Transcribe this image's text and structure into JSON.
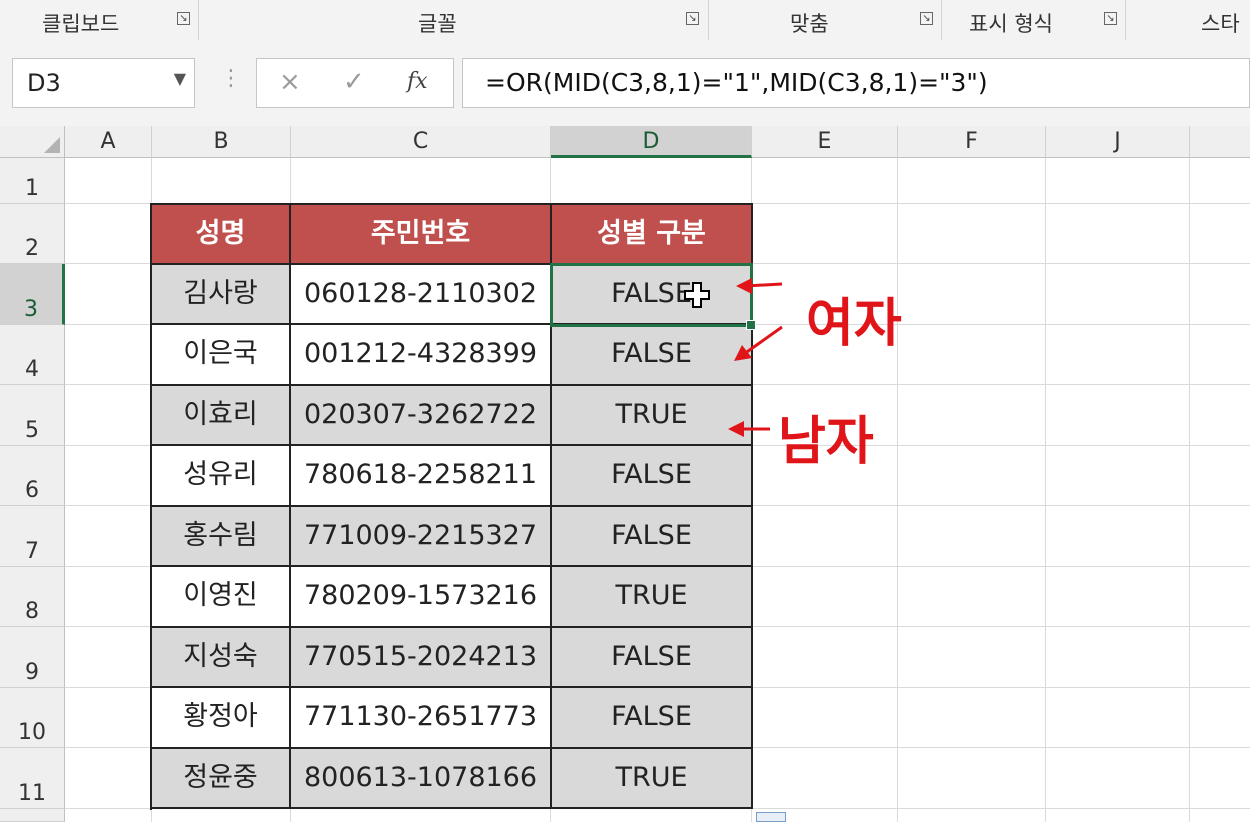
{
  "ribbon": {
    "groups": [
      {
        "label": "클립보드"
      },
      {
        "label": "글꼴"
      },
      {
        "label": "맞춤"
      },
      {
        "label": "표시 형식"
      },
      {
        "label": "스타"
      }
    ]
  },
  "formula_bar": {
    "name_box": "D3",
    "cancel_icon": "×",
    "enter_icon": "✓",
    "fx_label": "fx",
    "formula": "=OR(MID(C3,8,1)=\"1\",MID(C3,8,1)=\"3\")"
  },
  "columns": [
    "A",
    "B",
    "C",
    "D",
    "E",
    "F",
    "J"
  ],
  "rows": [
    "1",
    "2",
    "3",
    "4",
    "5",
    "6",
    "7",
    "8",
    "9",
    "10",
    "11"
  ],
  "table": {
    "headers": [
      "성명",
      "주민번호",
      "성별 구분"
    ],
    "rows": [
      [
        "김사랑",
        "060128-2110302",
        "FALSE"
      ],
      [
        "이은국",
        "001212-4328399",
        "FALSE"
      ],
      [
        "이효리",
        "020307-3262722",
        "TRUE"
      ],
      [
        "성유리",
        "780618-2258211",
        "FALSE"
      ],
      [
        "홍수림",
        "771009-2215327",
        "FALSE"
      ],
      [
        "이영진",
        "780209-1573216",
        "TRUE"
      ],
      [
        "지성숙",
        "770515-2024213",
        "FALSE"
      ],
      [
        "황정아",
        "771130-2651773",
        "FALSE"
      ],
      [
        "정윤중",
        "800613-1078166",
        "TRUE"
      ]
    ]
  },
  "annotations": {
    "female": "여자",
    "male": "남자",
    "color": "#e0151a"
  },
  "selected_cell": "D3"
}
